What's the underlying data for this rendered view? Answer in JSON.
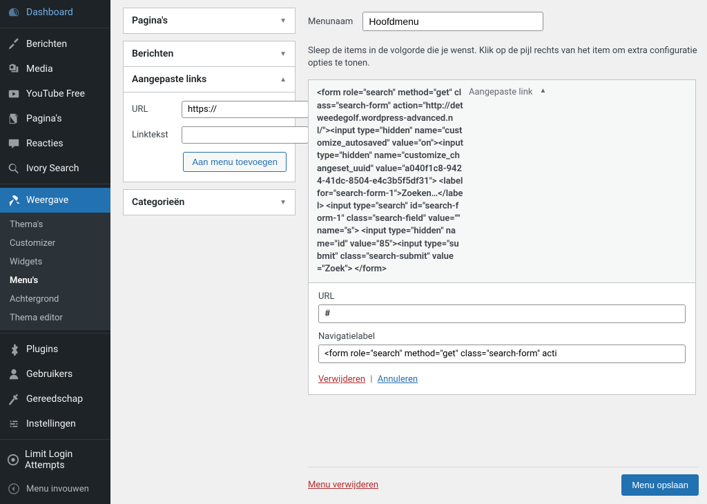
{
  "sidebar": {
    "items": [
      {
        "label": "Dashboard",
        "icon": "dashboard"
      },
      {
        "label": "Berichten",
        "icon": "pin"
      },
      {
        "label": "Media",
        "icon": "media"
      },
      {
        "label": "YouTube Free",
        "icon": "youtube"
      },
      {
        "label": "Pagina's",
        "icon": "pages"
      },
      {
        "label": "Reacties",
        "icon": "comments"
      },
      {
        "label": "Ivory Search",
        "icon": "search"
      },
      {
        "label": "Weergave",
        "icon": "appearance"
      },
      {
        "label": "Plugins",
        "icon": "plugins"
      },
      {
        "label": "Gebruikers",
        "icon": "users"
      },
      {
        "label": "Gereedschap",
        "icon": "tools"
      },
      {
        "label": "Instellingen",
        "icon": "settings"
      },
      {
        "label": "Limit Login Attempts",
        "icon": "limit"
      },
      {
        "label": "Menu invouwen",
        "icon": "collapse"
      }
    ],
    "submenu": {
      "items": [
        "Thema's",
        "Customizer",
        "Widgets",
        "Menu's",
        "Achtergrond",
        "Thema editor"
      ],
      "current_index": 3
    }
  },
  "metaboxes": {
    "pages": {
      "title": "Pagina's"
    },
    "posts": {
      "title": "Berichten"
    },
    "custom_links": {
      "title": "Aangepaste links",
      "url_label": "URL",
      "url_value": "https://",
      "link_text_label": "Linktekst",
      "add_button": "Aan menu toevoegen"
    },
    "categories": {
      "title": "Categorieën"
    }
  },
  "menu_edit": {
    "name_label": "Menunaam",
    "name_value": "Hoofdmenu",
    "instructions": "Sleep de items in de volgorde die je wenst. Klik op de pijl rechts van het item om extra configuratie opties te tonen.",
    "item": {
      "title_text": "<form role=\"search\" method=\"get\" class=\"search-form\" action=\"http://detweedegolf.wordpress-advanced.nl/\"><input type=\"hidden\" name=\"customize_autosaved\" value=\"on\"><input type=\"hidden\" name=\"customize_changeset_uuid\" value=\"a040f1c8-9424-41dc-8504-e4c3b5f5df31\"> <label for=\"search-form-1\">Zoeken…</label> <input type=\"search\" id=\"search-form-1\" class=\"search-field\" value=\"\" name=\"s\"> <input type=\"hidden\" name=\"id\" value=\"85\"><input type=\"submit\" class=\"search-submit\" value=\"Zoek\"> </form>",
      "type": "Aangepaste link",
      "url_label": "URL",
      "url_value": "#",
      "nav_label": "Navigatielabel",
      "nav_value": "<form role=\"search\" method=\"get\" class=\"search-form\" acti",
      "remove": "Verwijderen",
      "cancel": "Annuleren"
    },
    "delete_menu": "Menu verwijderen",
    "save_button": "Menu opslaan"
  }
}
